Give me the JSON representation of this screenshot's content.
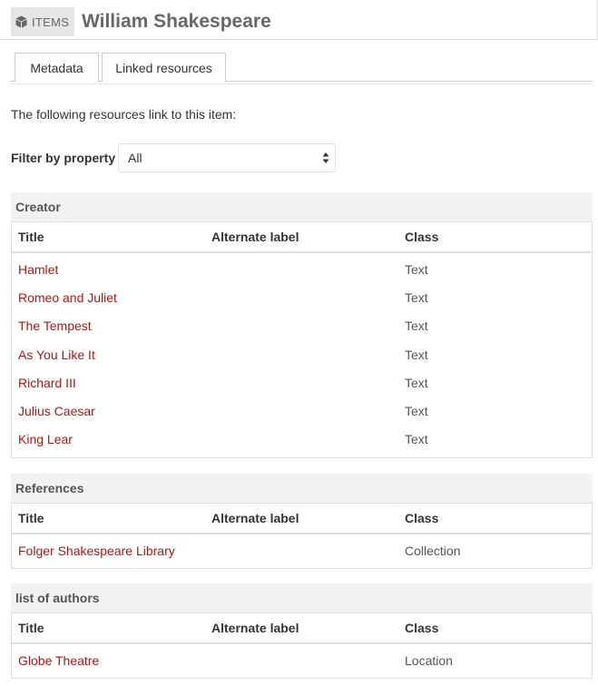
{
  "header": {
    "badge_label": "ITEMS",
    "title": "William Shakespeare"
  },
  "tabs": [
    {
      "label": "Metadata",
      "active": false
    },
    {
      "label": "Linked resources",
      "active": true
    }
  ],
  "intro_text": "The following resources link to this item:",
  "filter": {
    "label": "Filter by property",
    "selected": "All"
  },
  "columns": {
    "title": "Title",
    "alternate_label": "Alternate label",
    "class": "Class"
  },
  "sections": [
    {
      "name": "Creator",
      "rows": [
        {
          "title": "Hamlet",
          "alternate_label": "",
          "class": "Text"
        },
        {
          "title": "Romeo and Juliet",
          "alternate_label": "",
          "class": "Text"
        },
        {
          "title": "The Tempest",
          "alternate_label": "",
          "class": "Text"
        },
        {
          "title": "As You Like It",
          "alternate_label": "",
          "class": "Text"
        },
        {
          "title": "Richard III",
          "alternate_label": "",
          "class": "Text"
        },
        {
          "title": "Julius Caesar",
          "alternate_label": "",
          "class": "Text"
        },
        {
          "title": "King Lear",
          "alternate_label": "",
          "class": "Text"
        }
      ]
    },
    {
      "name": "References",
      "rows": [
        {
          "title": "Folger Shakespeare Library",
          "alternate_label": "",
          "class": "Collection"
        }
      ]
    },
    {
      "name": "list of authors",
      "rows": [
        {
          "title": "Globe Theatre",
          "alternate_label": "",
          "class": "Location"
        }
      ]
    }
  ],
  "colors": {
    "link": "#a91919",
    "section_header_bg": "#f2f2f2",
    "badge_bg": "#e6e6e6"
  },
  "icons": {
    "badge": "cube-icon",
    "select": "select-arrows-icon"
  }
}
